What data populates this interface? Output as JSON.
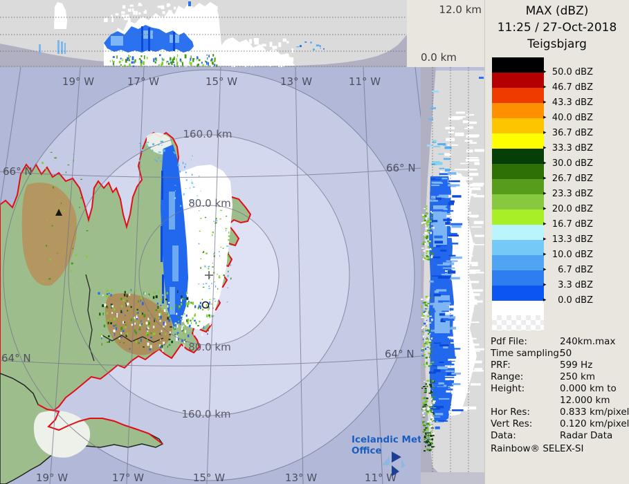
{
  "header": {
    "product": "MAX (dBZ)",
    "timestamp": "11:25 / 27-Oct-2018",
    "station": "Teigsbjarg"
  },
  "axes": {
    "height_max": "12.0 km",
    "height_min": "0.0 km"
  },
  "legend": {
    "unit": "dBZ",
    "entries": [
      {
        "label": "50.0 dBZ",
        "color": "#000000"
      },
      {
        "label": "46.7 dBZ",
        "color": "#b40000"
      },
      {
        "label": "43.3 dBZ",
        "color": "#ef3b00"
      },
      {
        "label": "40.0 dBZ",
        "color": "#ff9000"
      },
      {
        "label": "36.7 dBZ",
        "color": "#fdc400"
      },
      {
        "label": "33.3 dBZ",
        "color": "#ffff00"
      },
      {
        "label": "30.0 dBZ",
        "color": "#073d07"
      },
      {
        "label": "26.7 dBZ",
        "color": "#2e6f06"
      },
      {
        "label": "23.3 dBZ",
        "color": "#579c1d"
      },
      {
        "label": "20.0 dBZ",
        "color": "#86c83e"
      },
      {
        "label": "16.7 dBZ",
        "color": "#a9ef28"
      },
      {
        "label": "13.3 dBZ",
        "color": "#baf4fd"
      },
      {
        "label": "10.0 dBZ",
        "color": "#74c9f7"
      },
      {
        "label": "6.7 dBZ",
        "color": "#4fa5f3"
      },
      {
        "label": "3.3 dBZ",
        "color": "#2c7ef1"
      },
      {
        "label": "0.0 dBZ",
        "color": "#0b55f3"
      }
    ]
  },
  "metadata": {
    "rows": [
      {
        "label": "Pdf File:",
        "value": "240km.max"
      },
      {
        "label": "Time sampling:",
        "value": "50"
      },
      {
        "label": "PRF:",
        "value": "599 Hz"
      },
      {
        "label": "Range:",
        "value": "250 km"
      },
      {
        "label": "Height:",
        "value": "0.000 km to"
      },
      {
        "label": "",
        "value": "12.000 km"
      },
      {
        "label": "Hor Res:",
        "value": "0.833 km/pixel"
      },
      {
        "label": "Vert Res:",
        "value": "0.120 km/pixel"
      },
      {
        "label": "Data:",
        "value": "Radar Data"
      }
    ],
    "footer": "Rainbow® SELEX-SI"
  },
  "map": {
    "lon_top": [
      "19° W",
      "17° W",
      "15° W",
      "13° W",
      "11° W"
    ],
    "lon_bottom": [
      "19° W",
      "17° W",
      "15° W",
      "13° W",
      "11° W"
    ],
    "lat_left": [
      "66° N",
      "64° N"
    ],
    "lat_right": [
      "66° N",
      "64° N"
    ],
    "rings": [
      "160.0 km",
      "80.0 km",
      "80.0 km",
      "160.0 km"
    ],
    "logo": {
      "line1": "Icelandic Met",
      "line2": "Office"
    }
  },
  "colors": {
    "sea_outer": "#b2b8d8",
    "sea_mid": "#c6cbe5",
    "sea_inner": "#d4d8ee",
    "sea_center": "#dfe2f4",
    "land": "#9dbd8d",
    "coast": "#e30d17",
    "panel_bg": "#dbdbdb",
    "wedge": "#b0b0c2",
    "sidebar_bg": "#e9e6df",
    "logo_blue": "#1b5ebc"
  }
}
